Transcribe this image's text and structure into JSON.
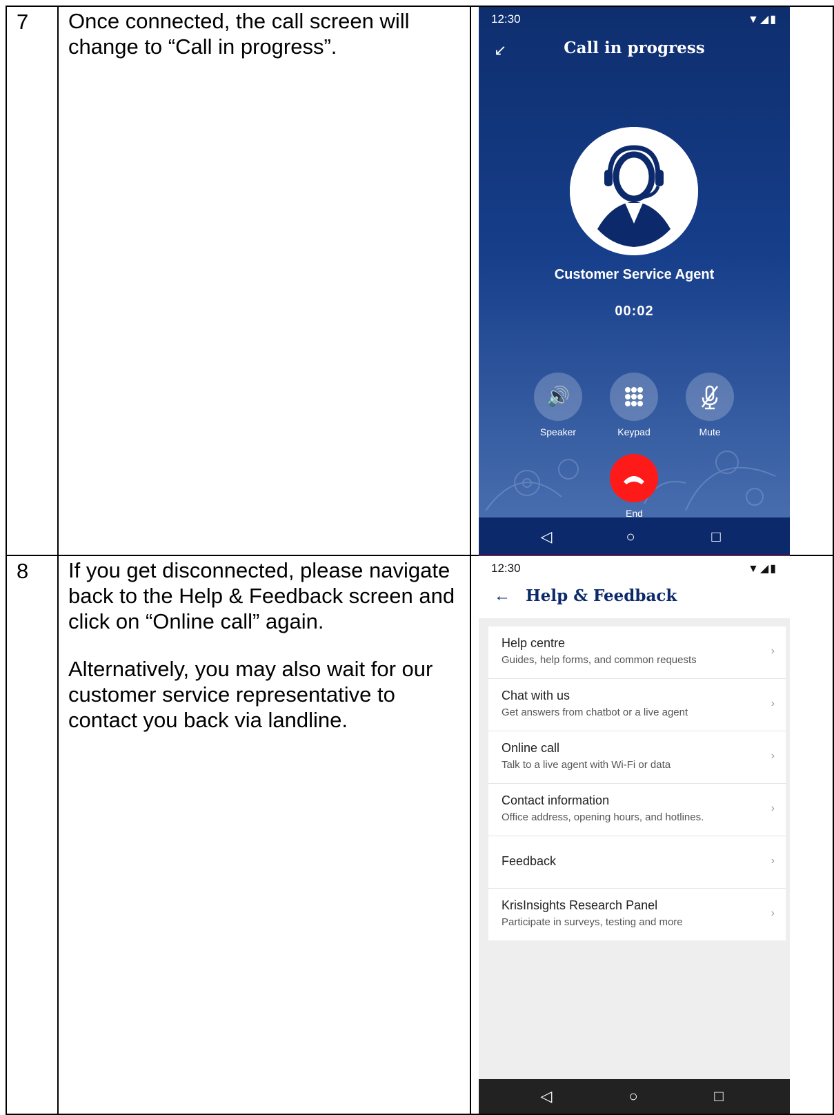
{
  "rows": [
    {
      "step": "7",
      "paragraphs": [
        "Once connected, the call screen will change to “Call in progress”."
      ]
    },
    {
      "step": "8",
      "paragraphs": [
        "If you get disconnected, please navigate back to the Help & Feedback screen and click on “Online call” again.",
        "Alternatively, you may also wait for our customer service representative to contact you back via landline."
      ]
    }
  ],
  "call_screen": {
    "time": "12:30",
    "title": "Call in progress",
    "agent_name": "Customer Service Agent",
    "timer": "00:02",
    "controls": [
      {
        "label": "Speaker",
        "icon": "speaker-icon"
      },
      {
        "label": "Keypad",
        "icon": "keypad-icon"
      },
      {
        "label": "Mute",
        "icon": "mute-icon"
      }
    ],
    "end_label": "End",
    "colors": {
      "background": "#0e2e6e",
      "end_button": "#ff1a1a"
    }
  },
  "help_screen": {
    "time": "12:30",
    "title": "Help & Feedback",
    "items": [
      {
        "title": "Help centre",
        "subtitle": "Guides, help forms, and common requests"
      },
      {
        "title": "Chat with us",
        "subtitle": "Get answers from chatbot or a live agent"
      },
      {
        "title": "Online call",
        "subtitle": "Talk to a live agent with Wi-Fi or data"
      },
      {
        "title": "Contact information",
        "subtitle": "Office address, opening hours, and hotlines."
      },
      {
        "title": "Feedback",
        "subtitle": ""
      },
      {
        "title": "KrisInsights Research Panel",
        "subtitle": "Participate in surveys, testing and more"
      }
    ],
    "colors": {
      "title": "#0c2a6b",
      "background": "#eeeeee"
    }
  }
}
